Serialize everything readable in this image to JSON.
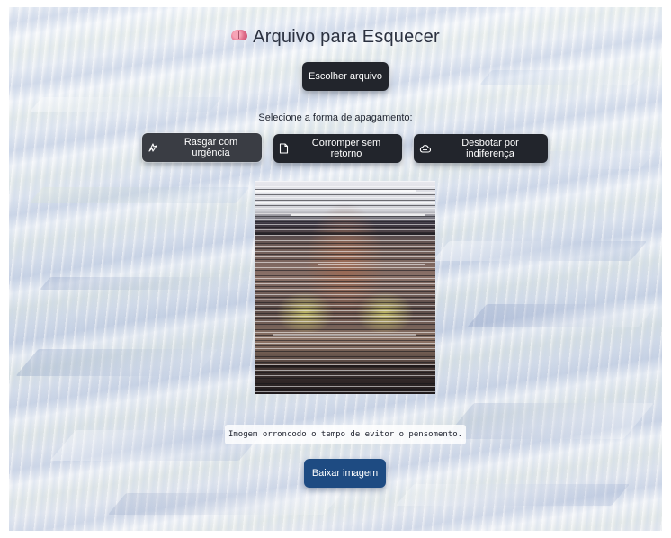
{
  "app": {
    "title": "Arquivo para Esquecer",
    "title_icon": "brain-icon"
  },
  "upload": {
    "choose_label": "Escolher arquivo"
  },
  "erase_modes": {
    "prompt": "Selecione a forma de apagamento:",
    "options": [
      {
        "label": "Rasgar com urgência",
        "icon": "tear-icon",
        "selected": true
      },
      {
        "label": "Corromper sem retorno",
        "icon": "document-icon",
        "selected": false
      },
      {
        "label": "Desbotar por indiferença",
        "icon": "cloud-icon",
        "selected": false
      }
    ]
  },
  "preview": {
    "caption": "Imogem orroncodo o tempo de evitor o pensomento."
  },
  "actions": {
    "download_label": "Baixar imagem"
  },
  "colors": {
    "dark_button": "#22252c",
    "active_button": "#3a3d44",
    "download_button": "#1e4b82",
    "title_text": "#2b3140"
  }
}
